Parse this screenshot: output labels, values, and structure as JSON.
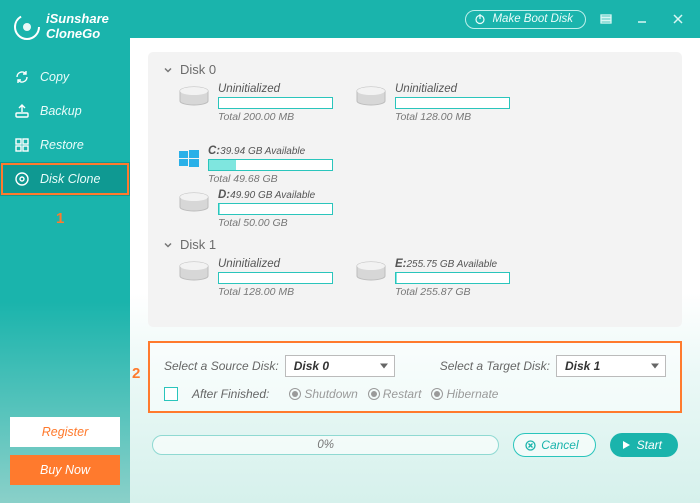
{
  "app": {
    "name_line1": "iSunshare",
    "name_line2": "CloneGo"
  },
  "titlebar": {
    "make_boot": "Make Boot Disk"
  },
  "sidebar": {
    "items": [
      {
        "label": "Copy"
      },
      {
        "label": "Backup"
      },
      {
        "label": "Restore"
      },
      {
        "label": "Disk Clone"
      }
    ],
    "register": "Register",
    "buy": "Buy Now",
    "step1": "1"
  },
  "disks": [
    {
      "header": "Disk 0",
      "partitions": [
        {
          "title_prefix": "",
          "title": "Uninitialized",
          "avail": "",
          "total": "Total 200.00 MB",
          "fill_pct": 0,
          "icon": "drive"
        },
        {
          "title_prefix": "",
          "title": "Uninitialized",
          "avail": "",
          "total": "Total 128.00 MB",
          "fill_pct": 0,
          "icon": "drive"
        },
        {
          "title_prefix": "C:",
          "title": "",
          "avail": "39.94 GB Available",
          "total": "Total 49.68 GB",
          "fill_pct": 22,
          "icon": "windows"
        },
        {
          "title_prefix": "D:",
          "title": "",
          "avail": "49.90 GB Available",
          "total": "Total 50.00 GB",
          "fill_pct": 1,
          "icon": "drive"
        }
      ]
    },
    {
      "header": "Disk 1",
      "partitions": [
        {
          "title_prefix": "",
          "title": "Uninitialized",
          "avail": "",
          "total": "Total 128.00 MB",
          "fill_pct": 0,
          "icon": "drive"
        },
        {
          "title_prefix": "E:",
          "title": "",
          "avail": "255.75 GB Available",
          "total": "Total 255.87 GB",
          "fill_pct": 1,
          "icon": "drive"
        }
      ]
    }
  ],
  "select": {
    "step2": "2",
    "source_label": "Select a Source Disk:",
    "source_value": "Disk 0",
    "target_label": "Select a Target Disk:",
    "target_value": "Disk 1",
    "after_label": "After Finished:",
    "opts": [
      "Shutdown",
      "Restart",
      "Hibernate"
    ]
  },
  "bottom": {
    "progress": "0%",
    "cancel": "Cancel",
    "start": "Start"
  }
}
